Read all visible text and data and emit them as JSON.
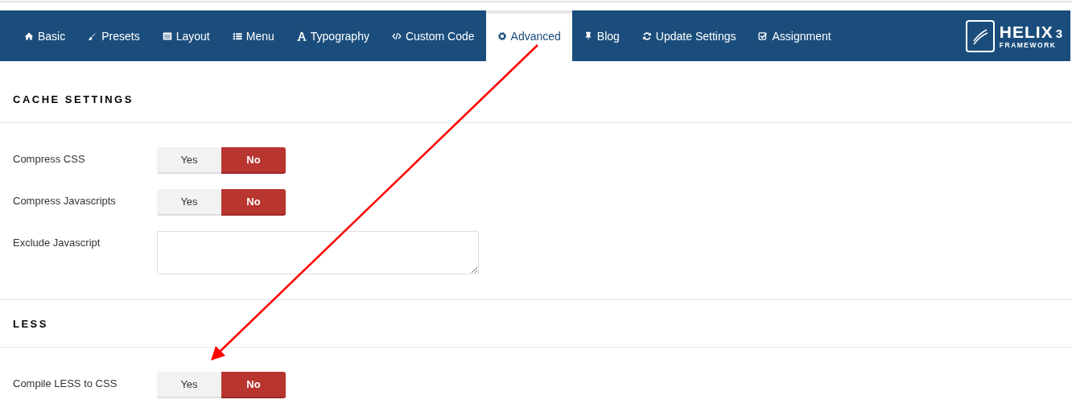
{
  "tabs": [
    {
      "label": "Basic",
      "selected": false
    },
    {
      "label": "Presets",
      "selected": false
    },
    {
      "label": "Layout",
      "selected": false
    },
    {
      "label": "Menu",
      "selected": false
    },
    {
      "label": "Typography",
      "selected": false
    },
    {
      "label": "Custom Code",
      "selected": false
    },
    {
      "label": "Advanced",
      "selected": true
    },
    {
      "label": "Blog",
      "selected": false
    },
    {
      "label": "Update Settings",
      "selected": false
    },
    {
      "label": "Assignment",
      "selected": false
    }
  ],
  "logo": {
    "name": "HELIX",
    "version": "3",
    "subtitle": "FRAMEWORK"
  },
  "sections": [
    {
      "title": "CACHE SETTINGS",
      "fields": [
        {
          "kind": "toggle",
          "label": "Compress CSS",
          "options": [
            {
              "label": "Yes",
              "selected": false
            },
            {
              "label": "No",
              "selected": true
            }
          ]
        },
        {
          "kind": "toggle",
          "label": "Compress Javascripts",
          "options": [
            {
              "label": "Yes",
              "selected": false
            },
            {
              "label": "No",
              "selected": true
            }
          ]
        },
        {
          "kind": "textarea",
          "label": "Exclude Javascript"
        }
      ]
    },
    {
      "title": "LESS",
      "fields": [
        {
          "kind": "toggle",
          "label": "Compile LESS to CSS",
          "options": [
            {
              "label": "Yes",
              "selected": false
            },
            {
              "label": "No",
              "selected": true
            }
          ]
        }
      ]
    }
  ]
}
